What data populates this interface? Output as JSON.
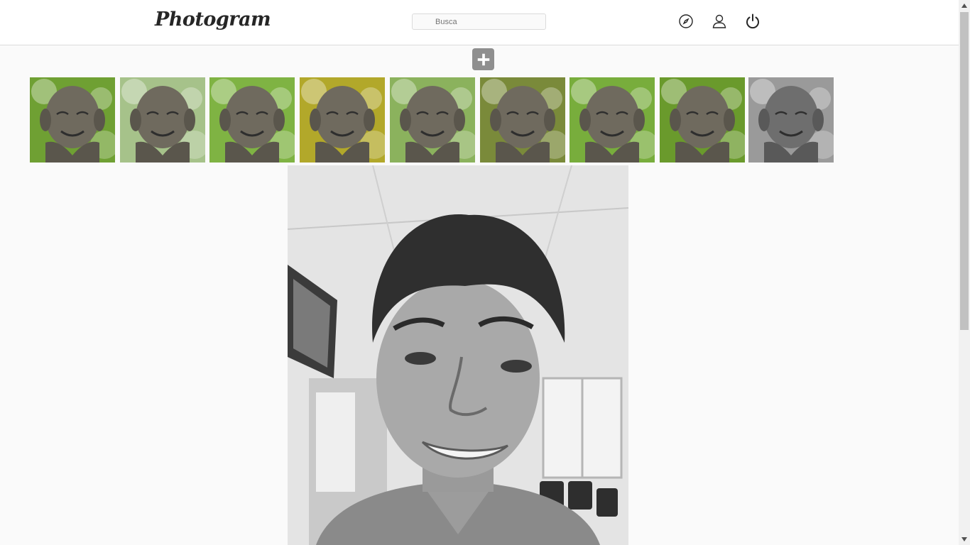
{
  "header": {
    "logo_text": "Photogram",
    "search": {
      "placeholder": "Busca",
      "value": ""
    },
    "icons": [
      "compass-icon",
      "user-icon",
      "power-icon"
    ]
  },
  "upload": {
    "icon": "plus-icon"
  },
  "filters": {
    "items": [
      {
        "icon": "buddha-statue-thumbnail",
        "tint": "#6fa033"
      },
      {
        "icon": "buddha-statue-thumbnail",
        "tint": "#a6c28a"
      },
      {
        "icon": "buddha-statue-thumbnail",
        "tint": "#7fb343"
      },
      {
        "icon": "buddha-statue-thumbnail",
        "tint": "#b2a82a"
      },
      {
        "icon": "buddha-statue-thumbnail",
        "tint": "#8bb25d"
      },
      {
        "icon": "buddha-statue-thumbnail",
        "tint": "#7a8a3a"
      },
      {
        "icon": "buddha-statue-thumbnail",
        "tint": "#78ad3c"
      },
      {
        "icon": "buddha-statue-thumbnail",
        "tint": "#6a9a2c"
      },
      {
        "icon": "buddha-statue-thumbnail",
        "tint": "#9a9a9a"
      }
    ],
    "selected_index": 8
  },
  "main_photo": {
    "icon": "portrait-photo-grayscale"
  },
  "colors": {
    "header_bg": "#ffffff",
    "page_bg": "#fafafa",
    "border": "#dbdbdb",
    "add_button_bg": "#8f8f8f"
  }
}
